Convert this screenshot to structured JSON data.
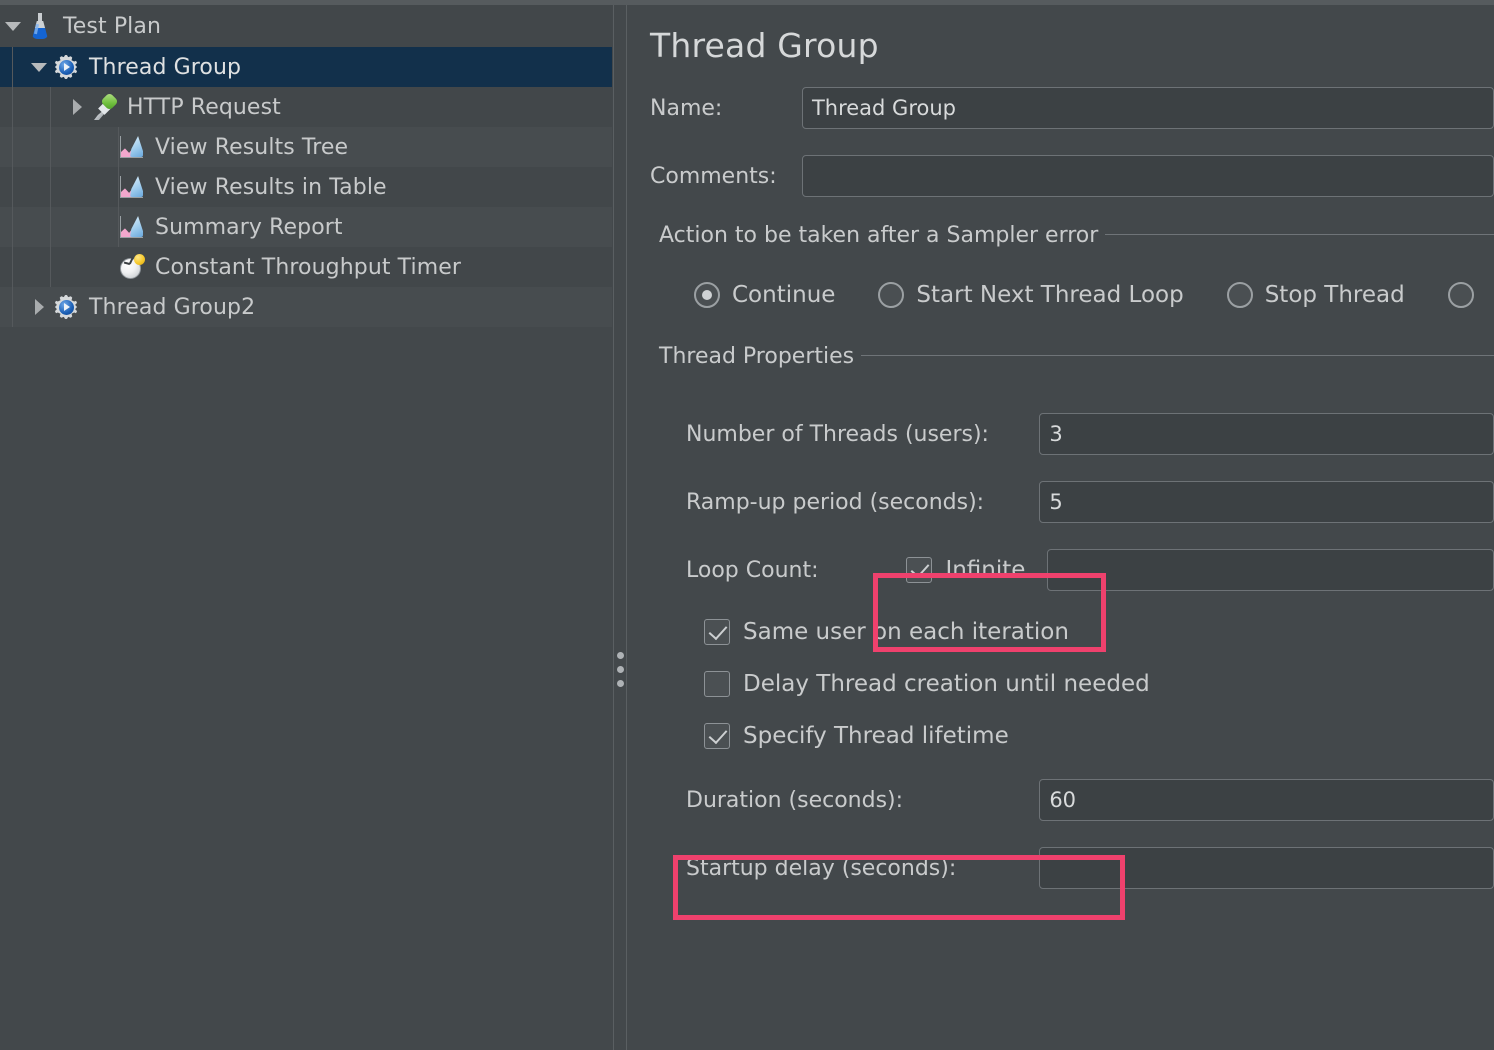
{
  "tree": {
    "name": "test-plan-tree",
    "items": [
      {
        "label": "Test Plan",
        "icon": "flask-icon",
        "depth": 0,
        "twisty": "down",
        "selected": false,
        "stripe": "base"
      },
      {
        "label": "Thread Group",
        "icon": "gear-icon",
        "depth": 1,
        "twisty": "down",
        "selected": true,
        "stripe": "sel"
      },
      {
        "label": "HTTP Request",
        "icon": "pipette-icon",
        "depth": 2,
        "twisty": "right",
        "selected": false,
        "stripe": "base"
      },
      {
        "label": "View Results Tree",
        "icon": "chart-icon",
        "depth": 2,
        "twisty": "none",
        "selected": false,
        "stripe": "alt"
      },
      {
        "label": "View Results in Table",
        "icon": "chart-icon",
        "depth": 2,
        "twisty": "none",
        "selected": false,
        "stripe": "base"
      },
      {
        "label": "Summary Report",
        "icon": "chart-icon",
        "depth": 2,
        "twisty": "none",
        "selected": false,
        "stripe": "alt"
      },
      {
        "label": "Constant Throughput Timer",
        "icon": "timer-icon",
        "depth": 2,
        "twisty": "none",
        "selected": false,
        "stripe": "base"
      },
      {
        "label": "Thread Group2",
        "icon": "gear-icon",
        "depth": 1,
        "twisty": "right",
        "selected": false,
        "stripe": "alt"
      }
    ]
  },
  "detail": {
    "title": "Thread Group",
    "name_label": "Name:",
    "name_value": "Thread Group",
    "comments_label": "Comments:",
    "comments_value": "",
    "sampler_error": {
      "caption": "Action to be taken after a Sampler error",
      "options": [
        {
          "label": "Continue",
          "selected": true
        },
        {
          "label": "Start Next Thread Loop",
          "selected": false
        },
        {
          "label": "Stop Thread",
          "selected": false
        },
        {
          "label": "",
          "selected": false
        }
      ]
    },
    "thread_properties": {
      "caption": "Thread Properties",
      "num_threads_label": "Number of Threads (users):",
      "num_threads_value": "3",
      "ramp_up_label": "Ramp-up period (seconds):",
      "ramp_up_value": "5",
      "loop_count_label": "Loop Count:",
      "loop_infinite_label": "Infinite",
      "loop_infinite_checked": true,
      "loop_count_value": "",
      "same_user_label": "Same user on each iteration",
      "same_user_checked": true,
      "delay_thread_label": "Delay Thread creation until needed",
      "delay_thread_checked": false,
      "specify_lifetime_label": "Specify Thread lifetime",
      "specify_lifetime_checked": true,
      "duration_label": "Duration (seconds):",
      "duration_value": "60",
      "startup_delay_label": "Startup delay (seconds):",
      "startup_delay_value": ""
    }
  },
  "annotations": {
    "highlight_color": "#ef416d",
    "boxes": [
      "loop-count-infinite",
      "duration-seconds"
    ]
  },
  "colors": {
    "pane_bg": "#43484b",
    "selection_bg": "#12304b",
    "field_bg": "#3c4144",
    "text": "#c9cbcc"
  }
}
